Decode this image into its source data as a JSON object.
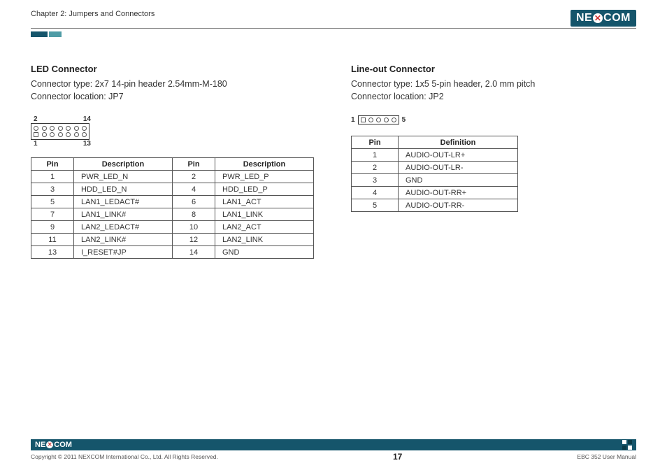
{
  "header": {
    "chapter": "Chapter 2: Jumpers and Connectors",
    "logo_text_left": "NE",
    "logo_text_right": "COM",
    "logo_x": "✕"
  },
  "led": {
    "title": "LED Connector",
    "type_label": "Connector type:",
    "type_value": "2x7 14-pin header 2.54mm-M-180",
    "loc_label": "Connector location: JP7",
    "diagram": {
      "tl": "2",
      "tr": "14",
      "bl": "1",
      "br": "13"
    },
    "th1": "Pin",
    "th2": "Description",
    "th3": "Pin",
    "th4": "Description",
    "rows": [
      [
        "1",
        "PWR_LED_N",
        "2",
        "PWR_LED_P"
      ],
      [
        "3",
        "HDD_LED_N",
        "4",
        "HDD_LED_P"
      ],
      [
        "5",
        "LAN1_LEDACT#",
        "6",
        "LAN1_ACT"
      ],
      [
        "7",
        "LAN1_LINK#",
        "8",
        "LAN1_LINK"
      ],
      [
        "9",
        "LAN2_LEDACT#",
        "10",
        "LAN2_ACT"
      ],
      [
        "11",
        "LAN2_LINK#",
        "12",
        "LAN2_LINK"
      ],
      [
        "13",
        "I_RESET#JP",
        "14",
        "GND"
      ]
    ]
  },
  "lineout": {
    "title": "Line-out Connector",
    "type_label": "Connector type: 1x5 5-pin header, 2.0 mm pitch",
    "loc_label": "Connector location: JP2",
    "diagram": {
      "left": "1",
      "right": "5"
    },
    "th1": "Pin",
    "th2": "Definition",
    "rows": [
      [
        "1",
        "AUDIO-OUT-LR+"
      ],
      [
        "2",
        "AUDIO-OUT-LR-"
      ],
      [
        "3",
        "GND"
      ],
      [
        "4",
        "AUDIO-OUT-RR+"
      ],
      [
        "5",
        "AUDIO-OUT-RR-"
      ]
    ]
  },
  "footer": {
    "copyright": "Copyright © 2011 NEXCOM International Co., Ltd. All Rights Reserved.",
    "page": "17",
    "doc": "EBC 352 User Manual"
  }
}
